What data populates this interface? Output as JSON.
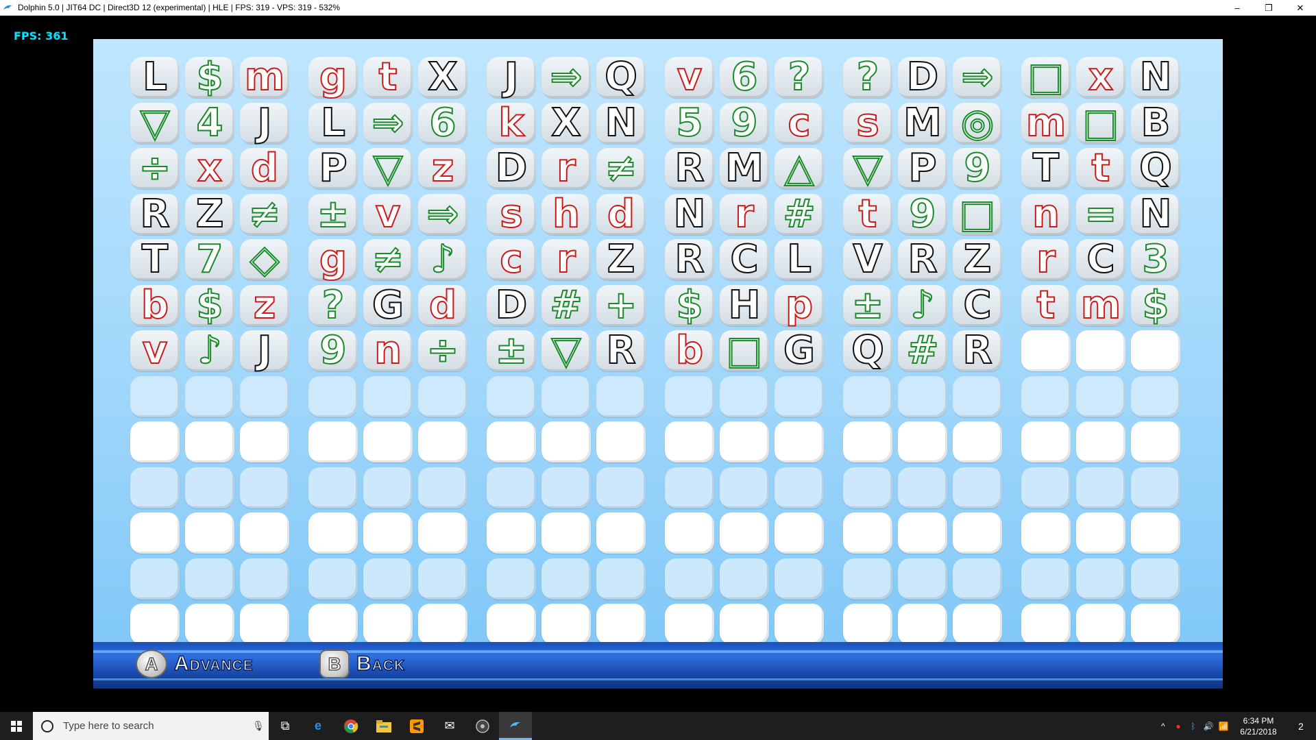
{
  "window": {
    "title": "Dolphin 5.0 | JIT64 DC | Direct3D 12 (experimental) | HLE | FPS: 319 - VPS: 319 - 532%",
    "minimize": "–",
    "restore": "❐",
    "close": "✕"
  },
  "overlay": {
    "fps": "FPS: 361"
  },
  "colors": {
    "black": "#111111",
    "red": "#cc1a1a",
    "green": "#1a8a2a"
  },
  "grid": {
    "columns": 18,
    "rows_total": 13,
    "filled_rows": [
      [
        [
          "L",
          "k"
        ],
        [
          "$",
          "g"
        ],
        [
          "m",
          "r"
        ],
        [
          "g",
          "r"
        ],
        [
          "t",
          "r"
        ],
        [
          "X",
          "k"
        ],
        [
          "J",
          "k"
        ],
        [
          "⇒",
          "g"
        ],
        [
          "Q",
          "k"
        ],
        [
          "v",
          "r"
        ],
        [
          "6",
          "g"
        ],
        [
          "?",
          "g"
        ],
        [
          "?",
          "g"
        ],
        [
          "D",
          "k"
        ],
        [
          "⇒",
          "g"
        ],
        [
          "□",
          "g"
        ],
        [
          "x",
          "r"
        ],
        [
          "N",
          "k"
        ]
      ],
      [
        [
          "▽",
          "g"
        ],
        [
          "4",
          "g"
        ],
        [
          "J",
          "k"
        ],
        [
          "L",
          "k"
        ],
        [
          "⇒",
          "g"
        ],
        [
          "6",
          "g"
        ],
        [
          "k",
          "r"
        ],
        [
          "X",
          "k"
        ],
        [
          "N",
          "k"
        ],
        [
          "5",
          "g"
        ],
        [
          "9",
          "g"
        ],
        [
          "c",
          "r"
        ],
        [
          "s",
          "r"
        ],
        [
          "M",
          "k"
        ],
        [
          "◎",
          "g"
        ],
        [
          "m",
          "r"
        ],
        [
          "□",
          "g"
        ],
        [
          "B",
          "k"
        ]
      ],
      [
        [
          "÷",
          "g"
        ],
        [
          "x",
          "r"
        ],
        [
          "d",
          "r"
        ],
        [
          "P",
          "k"
        ],
        [
          "▽",
          "g"
        ],
        [
          "z",
          "r"
        ],
        [
          "D",
          "k"
        ],
        [
          "r",
          "r"
        ],
        [
          "≠",
          "g"
        ],
        [
          "R",
          "k"
        ],
        [
          "M",
          "k"
        ],
        [
          "△",
          "g"
        ],
        [
          "▽",
          "g"
        ],
        [
          "P",
          "k"
        ],
        [
          "9",
          "g"
        ],
        [
          "T",
          "k"
        ],
        [
          "t",
          "r"
        ],
        [
          "Q",
          "k"
        ]
      ],
      [
        [
          "R",
          "k"
        ],
        [
          "Z",
          "k"
        ],
        [
          "≠",
          "g"
        ],
        [
          "±",
          "g"
        ],
        [
          "v",
          "r"
        ],
        [
          "⇒",
          "g"
        ],
        [
          "s",
          "r"
        ],
        [
          "h",
          "r"
        ],
        [
          "d",
          "r"
        ],
        [
          "N",
          "k"
        ],
        [
          "r",
          "r"
        ],
        [
          "#",
          "g"
        ],
        [
          "t",
          "r"
        ],
        [
          "9",
          "g"
        ],
        [
          "□",
          "g"
        ],
        [
          "n",
          "r"
        ],
        [
          "=",
          "g"
        ],
        [
          "N",
          "k"
        ]
      ],
      [
        [
          "T",
          "k"
        ],
        [
          "7",
          "g"
        ],
        [
          "◇",
          "g"
        ],
        [
          "g",
          "r"
        ],
        [
          "≠",
          "g"
        ],
        [
          "♪",
          "g"
        ],
        [
          "c",
          "r"
        ],
        [
          "r",
          "r"
        ],
        [
          "Z",
          "k"
        ],
        [
          "R",
          "k"
        ],
        [
          "C",
          "k"
        ],
        [
          "L",
          "k"
        ],
        [
          "V",
          "k"
        ],
        [
          "R",
          "k"
        ],
        [
          "Z",
          "k"
        ],
        [
          "r",
          "r"
        ],
        [
          "C",
          "k"
        ],
        [
          "3",
          "g"
        ]
      ],
      [
        [
          "b",
          "r"
        ],
        [
          "$",
          "g"
        ],
        [
          "z",
          "r"
        ],
        [
          "?",
          "g"
        ],
        [
          "G",
          "k"
        ],
        [
          "d",
          "r"
        ],
        [
          "D",
          "k"
        ],
        [
          "#",
          "g"
        ],
        [
          "+",
          "g"
        ],
        [
          "$",
          "g"
        ],
        [
          "H",
          "k"
        ],
        [
          "p",
          "r"
        ],
        [
          "±",
          "g"
        ],
        [
          "♪",
          "g"
        ],
        [
          "C",
          "k"
        ],
        [
          "t",
          "r"
        ],
        [
          "m",
          "r"
        ],
        [
          "$",
          "g"
        ]
      ],
      [
        [
          "v",
          "r"
        ],
        [
          "♪",
          "g"
        ],
        [
          "J",
          "k"
        ],
        [
          "9",
          "g"
        ],
        [
          "n",
          "r"
        ],
        [
          "÷",
          "g"
        ],
        [
          "±",
          "g"
        ],
        [
          "▽",
          "g"
        ],
        [
          "R",
          "k"
        ],
        [
          "b",
          "r"
        ],
        [
          "□",
          "g"
        ],
        [
          "G",
          "k"
        ],
        [
          "Q",
          "k"
        ],
        [
          "#",
          "g"
        ],
        [
          "R",
          "k"
        ],
        [
          "",
          ""
        ],
        [
          "",
          ""
        ],
        [
          "",
          ""
        ]
      ]
    ]
  },
  "controls": {
    "a_button": "A",
    "a_label": "Advance",
    "b_button": "B",
    "b_label": "Back"
  },
  "taskbar": {
    "search_placeholder": "Type here to search",
    "time": "6:34 PM",
    "date": "6/21/2018",
    "notification_count": "2"
  }
}
